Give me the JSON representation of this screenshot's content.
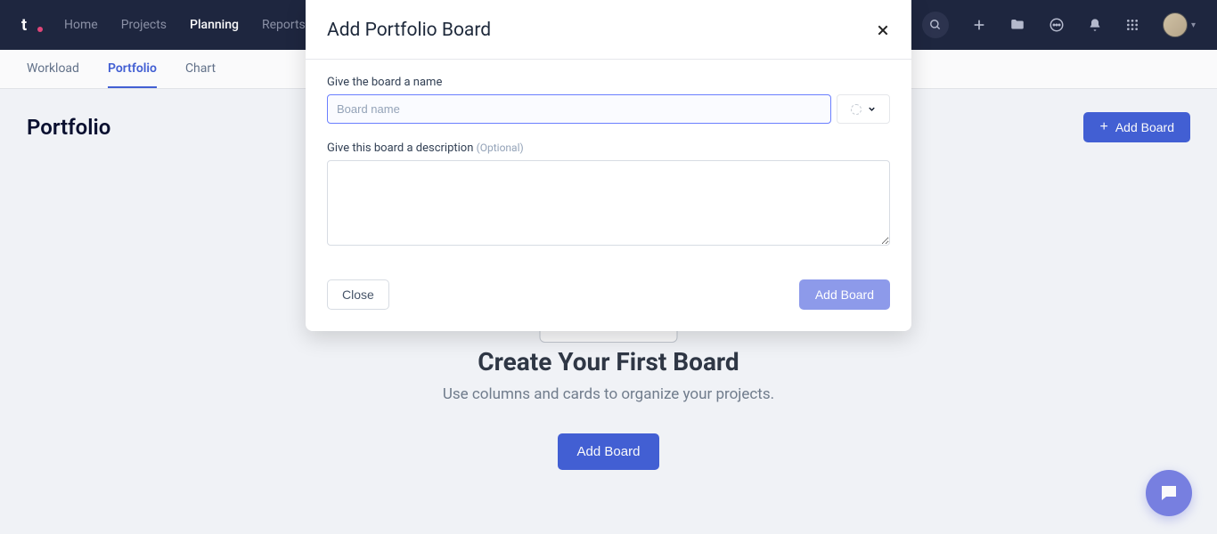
{
  "nav": {
    "links": [
      "Home",
      "Projects",
      "Planning",
      "Reports"
    ],
    "active": "Planning"
  },
  "subnav": {
    "tabs": [
      "Workload",
      "Portfolio",
      "Chart"
    ],
    "active": "Portfolio"
  },
  "page": {
    "title": "Portfolio",
    "add_board": "Add Board"
  },
  "empty": {
    "title": "Create Your First Board",
    "subtitle": "Use columns and cards to organize your projects.",
    "cta": "Add Board"
  },
  "modal": {
    "title": "Add Portfolio Board",
    "name_label": "Give the board a name",
    "name_placeholder": "Board name",
    "desc_label": "Give this board a description ",
    "desc_optional": "(Optional)",
    "close": "Close",
    "submit": "Add Board"
  }
}
